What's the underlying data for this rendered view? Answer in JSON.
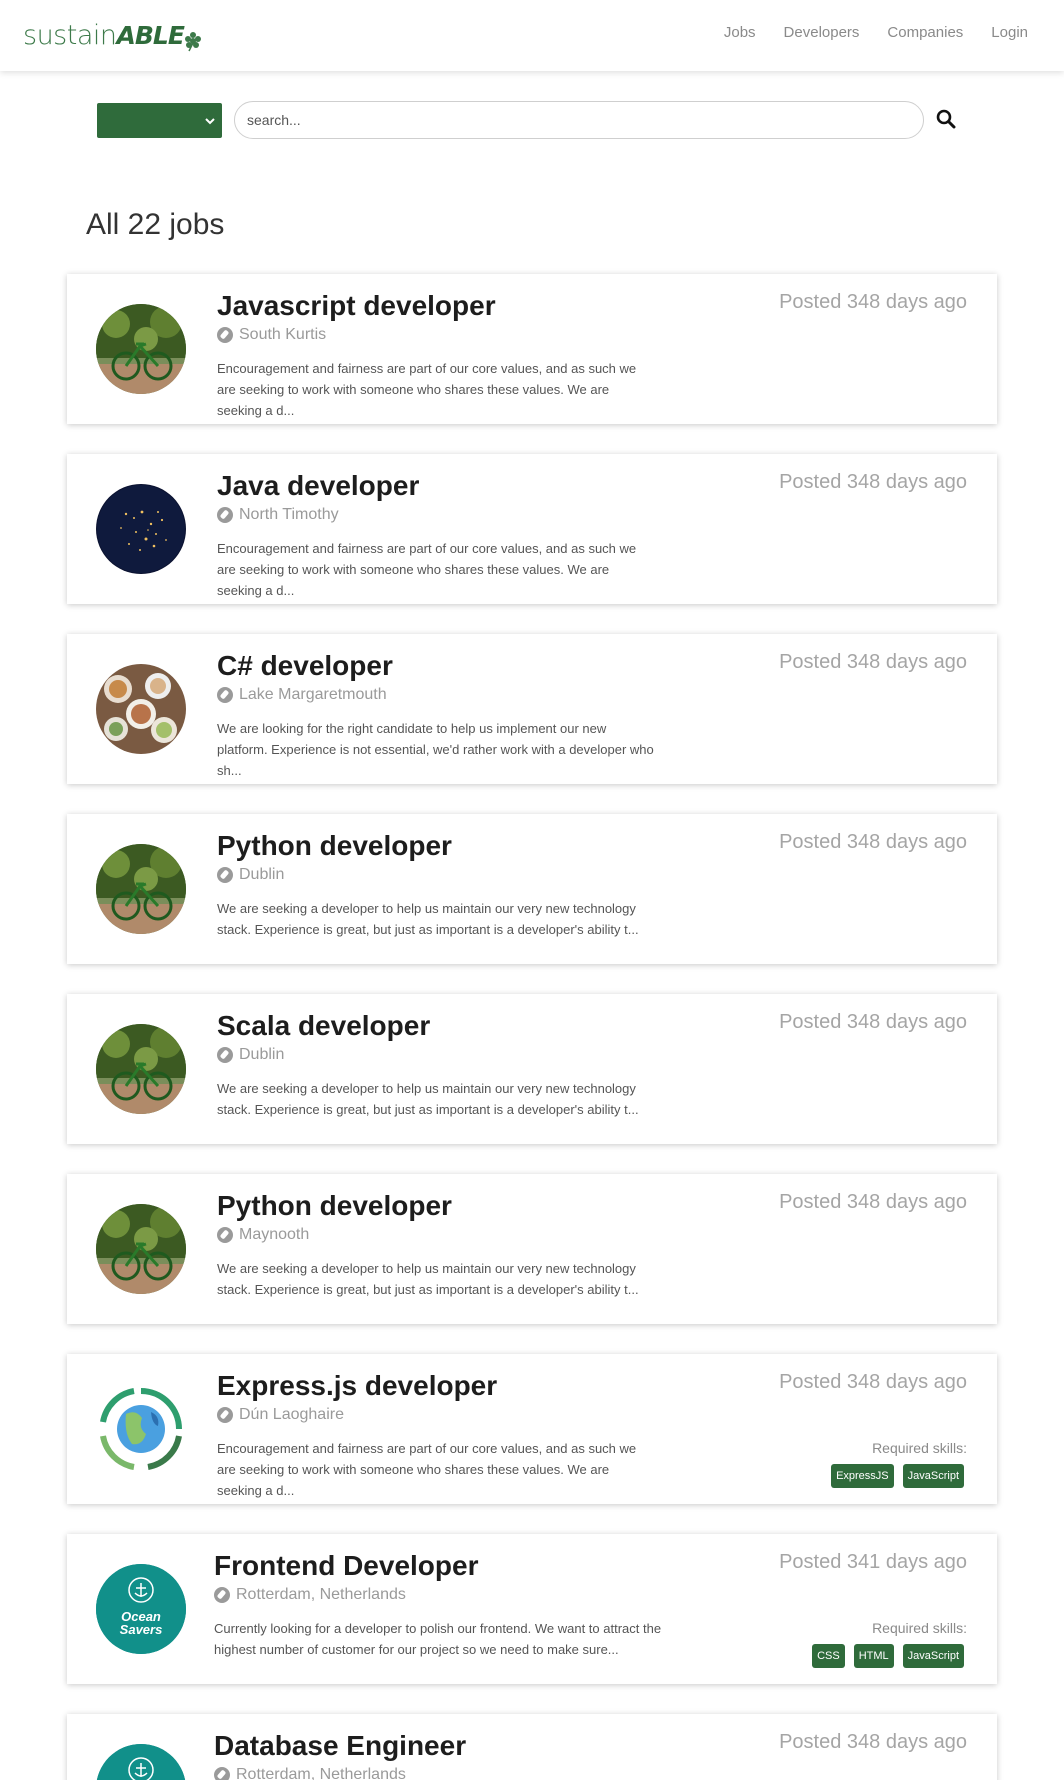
{
  "nav": {
    "logo_light": "sustain",
    "logo_bold": "ABLE",
    "links": [
      "Jobs",
      "Developers",
      "Companies",
      "Login"
    ]
  },
  "search": {
    "placeholder": "search...",
    "category_value": ""
  },
  "heading": "All 22 jobs",
  "jobs": [
    {
      "title": "Javascript developer",
      "location": "South Kurtis",
      "posted": "Posted 348 days ago",
      "description": "Encouragement and fairness are part of our core values, and as such we are seeking to work with someone who shares these values. We are seeking a d...",
      "logo": "bike-photo",
      "skills_label": "",
      "skills": []
    },
    {
      "title": "Java developer",
      "location": "North Timothy",
      "posted": "Posted 348 days ago",
      "description": "Encouragement and fairness are part of our core values, and as such we are seeking to work with someone who shares these values. We are seeking a d...",
      "logo": "earth-night-photo",
      "skills_label": "",
      "skills": []
    },
    {
      "title": "C# developer",
      "location": "Lake Margaretmouth",
      "posted": "Posted 348 days ago",
      "description": "We are looking for the right candidate to help us implement our new platform. Experience is not essential, we'd rather work with a developer who sh...",
      "logo": "food-table-photo",
      "skills_label": "",
      "skills": []
    },
    {
      "title": "Python developer",
      "location": "Dublin",
      "posted": "Posted 348 days ago",
      "description": "We are seeking a developer to help us maintain our very new technology stack. Experience is great, but just as important is a developer's ability t...",
      "logo": "bike-photo",
      "skills_label": "",
      "skills": []
    },
    {
      "title": "Scala developer",
      "location": "Dublin",
      "posted": "Posted 348 days ago",
      "description": "We are seeking a developer to help us maintain our very new technology stack. Experience is great, but just as important is a developer's ability t...",
      "logo": "bike-photo",
      "skills_label": "",
      "skills": []
    },
    {
      "title": "Python developer",
      "location": "Maynooth",
      "posted": "Posted 348 days ago",
      "description": "We are seeking a developer to help us maintain our very new technology stack. Experience is great, but just as important is a developer's ability t...",
      "logo": "bike-photo",
      "skills_label": "",
      "skills": []
    },
    {
      "title": "Express.js developer",
      "location": "Dún Laoghaire",
      "posted": "Posted 348 days ago",
      "description": "Encouragement and fairness are part of our core values, and as such we are seeking to work with someone who shares these values. We are seeking a d...",
      "logo": "globe-recycle-logo",
      "skills_label": "Required skills:",
      "skills": [
        "ExpressJS",
        "JavaScript"
      ]
    },
    {
      "title": "Frontend Developer",
      "location": "Rotterdam, Netherlands",
      "posted": "Posted 341 days ago",
      "description": "Currently looking for a developer to polish our frontend. We want to attract the highest number of customer for our project so we need to make sure...",
      "logo": "ocean-savers-logo",
      "logo_text": "Ocean Savers",
      "skills_label": "Required skills:",
      "skills": [
        "CSS",
        "HTML",
        "JavaScript"
      ]
    },
    {
      "title": "Database Engineer",
      "location": "Rotterdam, Netherlands",
      "posted": "Posted 348 days ago",
      "description": "",
      "logo": "ocean-savers-logo",
      "skills_label": "",
      "skills": []
    }
  ],
  "colors": {
    "brand_green": "#2f6b3b",
    "ocean_teal": "#11908a"
  }
}
